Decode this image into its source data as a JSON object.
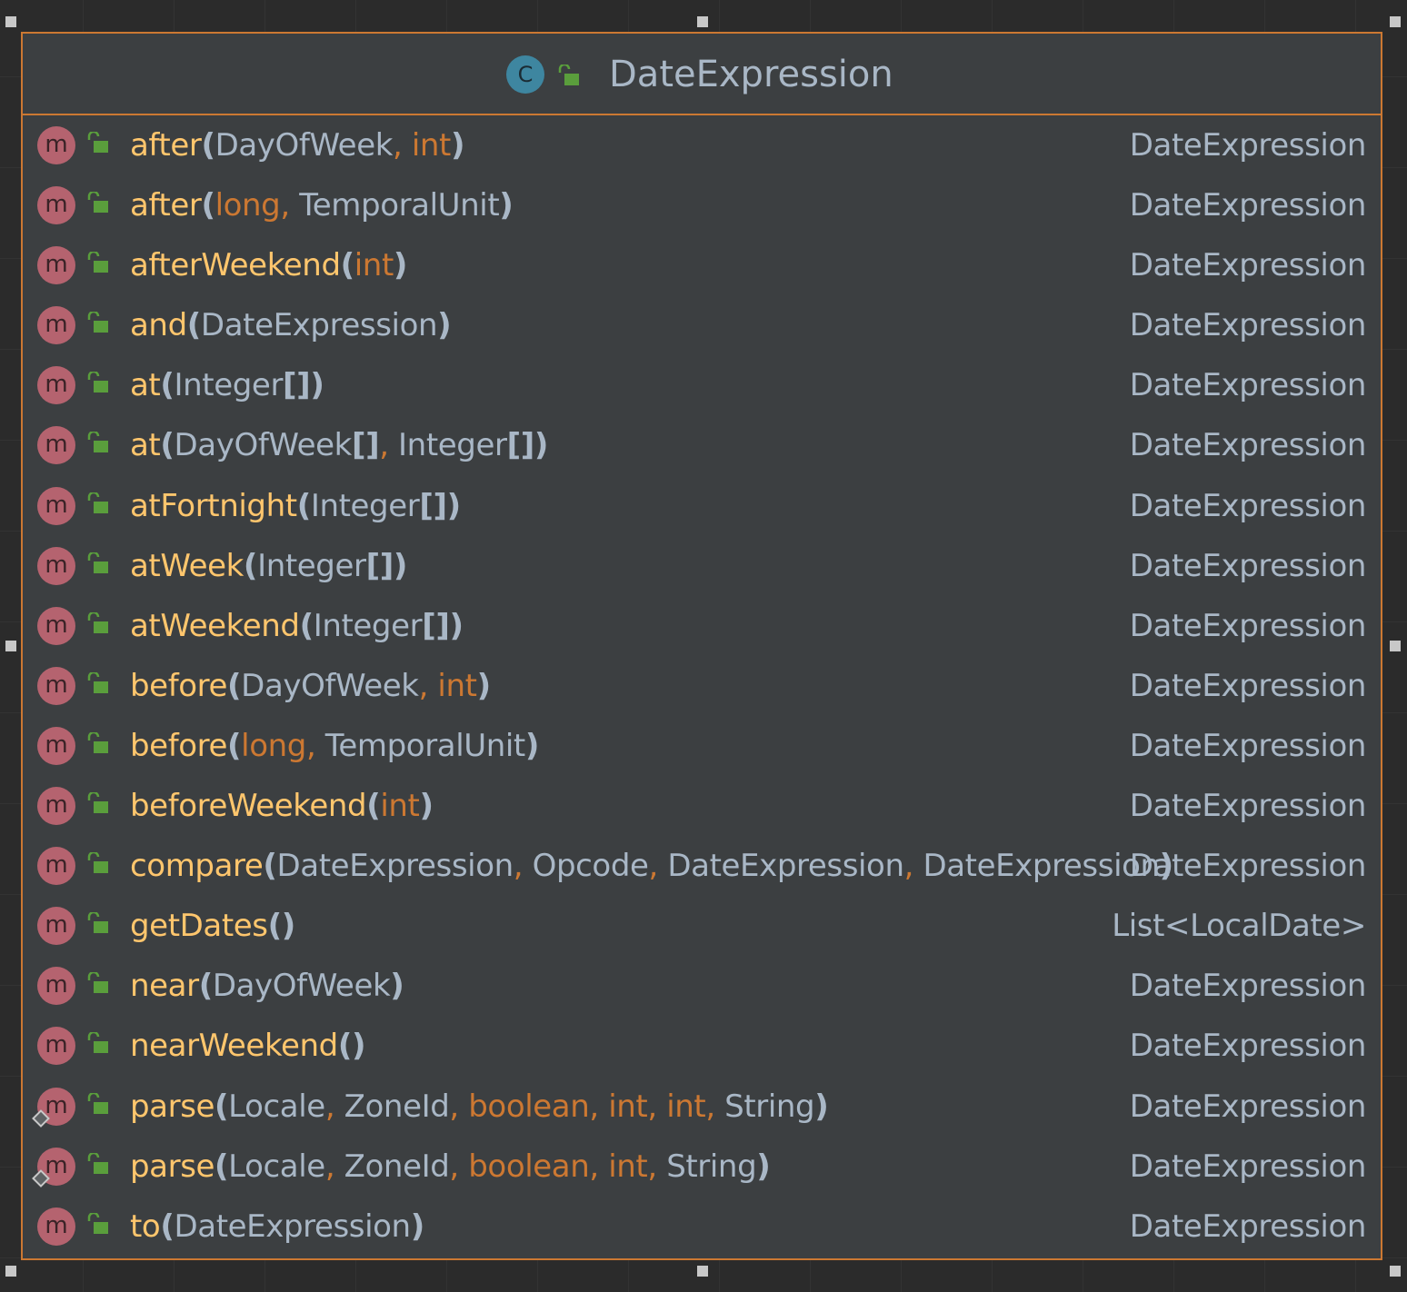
{
  "class": {
    "name": "DateExpression",
    "icon_letter": "C"
  },
  "icon_letter": "m",
  "methods": [
    {
      "name": "after",
      "params": [
        "DayOfWeek",
        "int"
      ],
      "returns": "DateExpression"
    },
    {
      "name": "after",
      "params": [
        "long",
        "TemporalUnit"
      ],
      "returns": "DateExpression"
    },
    {
      "name": "afterWeekend",
      "params": [
        "int"
      ],
      "returns": "DateExpression"
    },
    {
      "name": "and",
      "params": [
        "DateExpression"
      ],
      "returns": "DateExpression"
    },
    {
      "name": "at",
      "params": [
        "Integer[]"
      ],
      "returns": "DateExpression"
    },
    {
      "name": "at",
      "params": [
        "DayOfWeek[]",
        "Integer[]"
      ],
      "returns": "DateExpression"
    },
    {
      "name": "atFortnight",
      "params": [
        "Integer[]"
      ],
      "returns": "DateExpression"
    },
    {
      "name": "atWeek",
      "params": [
        "Integer[]"
      ],
      "returns": "DateExpression"
    },
    {
      "name": "atWeekend",
      "params": [
        "Integer[]"
      ],
      "returns": "DateExpression"
    },
    {
      "name": "before",
      "params": [
        "DayOfWeek",
        "int"
      ],
      "returns": "DateExpression"
    },
    {
      "name": "before",
      "params": [
        "long",
        "TemporalUnit"
      ],
      "returns": "DateExpression"
    },
    {
      "name": "beforeWeekend",
      "params": [
        "int"
      ],
      "returns": "DateExpression"
    },
    {
      "name": "compare",
      "params": [
        "DateExpression",
        "Opcode",
        "DateExpression",
        "DateExpression"
      ],
      "returns": "DateExpression"
    },
    {
      "name": "getDates",
      "params": [],
      "returns": "List<LocalDate>"
    },
    {
      "name": "near",
      "params": [
        "DayOfWeek"
      ],
      "returns": "DateExpression"
    },
    {
      "name": "nearWeekend",
      "params": [],
      "returns": "DateExpression"
    },
    {
      "name": "parse",
      "params": [
        "Locale",
        "ZoneId",
        "boolean",
        "int",
        "int",
        "String"
      ],
      "returns": "DateExpression",
      "protected_marker": true
    },
    {
      "name": "parse",
      "params": [
        "Locale",
        "ZoneId",
        "boolean",
        "int",
        "String"
      ],
      "returns": "DateExpression",
      "protected_marker": true
    },
    {
      "name": "to",
      "params": [
        "DateExpression"
      ],
      "returns": "DateExpression"
    }
  ],
  "primitive_types": [
    "int",
    "long",
    "boolean"
  ],
  "colors": {
    "border": "#cc7832",
    "method_name": "#ffc66d",
    "type_text": "#a9b7c6",
    "primitive": "#cc7832",
    "lock": "#5a9e3c",
    "method_icon": "#b5636f",
    "class_icon": "#3e86a0"
  }
}
